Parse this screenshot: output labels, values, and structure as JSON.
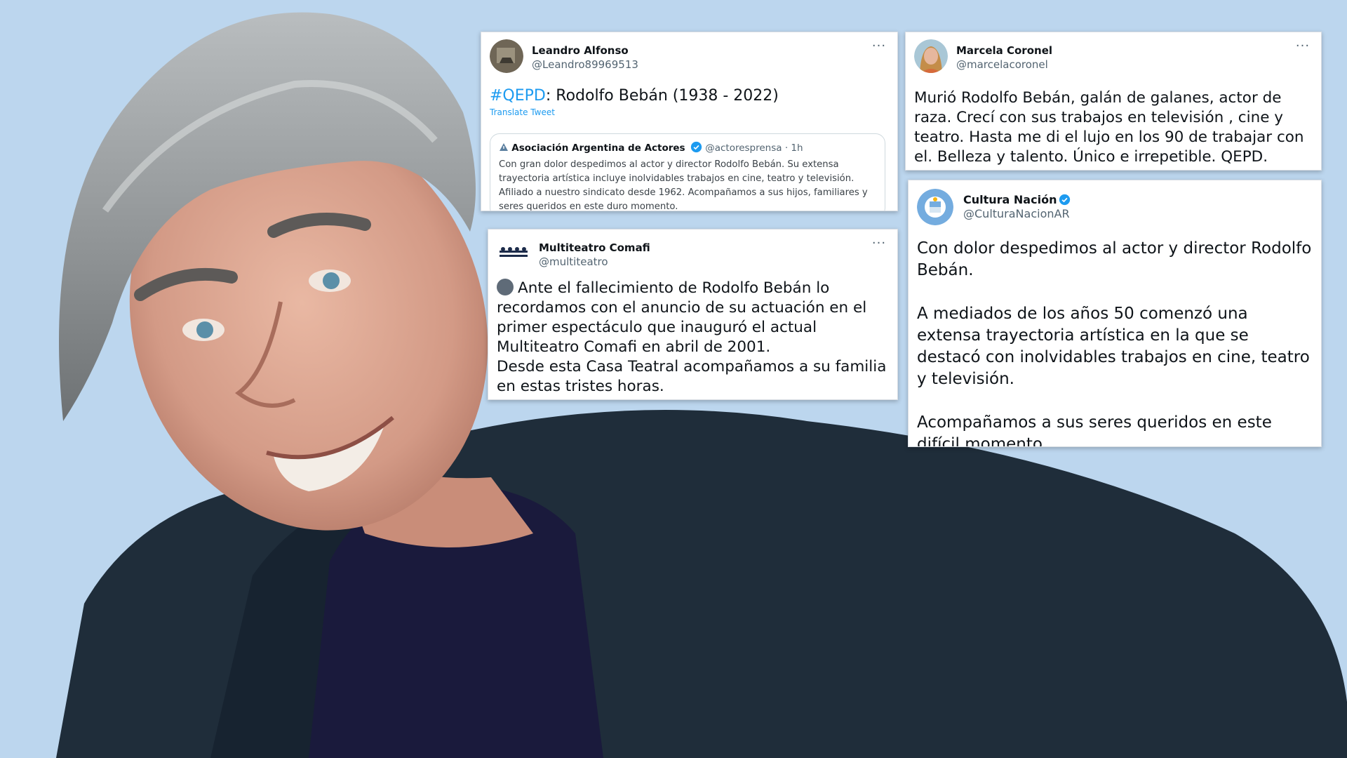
{
  "tweets": {
    "leandro": {
      "name": "Leandro Alfonso",
      "handle": "@Leandro89969513",
      "more": "···",
      "hashtag": "#QEPD",
      "text": ": Rodolfo Bebán (1938 - 2022)",
      "translate": "Translate Tweet",
      "quote": {
        "name": "Asociación Argentina de Actores",
        "handle": "@actoresprensa",
        "sep": " · ",
        "time": "1h",
        "text": "Con gran dolor despedimos al actor y director Rodolfo Bebán. Su extensa trayectoria artística incluye inolvidables trabajos en cine, teatro y televisión. Afiliado a nuestro sindicato desde 1962. Acompañamos a sus hijos, familiares y seres queridos en este duro momento."
      }
    },
    "multiteatro": {
      "name": "Multiteatro Comafi",
      "handle": "@multiteatro",
      "more": "···",
      "line1": "Ante el fallecimiento de Rodolfo Bebán lo recordamos con el anuncio de su actuación en el primer espectáculo que inauguró el actual Multiteatro Comafi en abril de 2001.",
      "line2": "Desde esta Casa Teatral acompañamos a su familia en estas tristes horas."
    },
    "marcela": {
      "name": "Marcela Coronel",
      "handle": "@marcelacoronel",
      "more": "···",
      "text": "Murió Rodolfo Bebán, galán de galanes, actor de raza. Crecí con sus trabajos en televisión , cine y teatro. Hasta me di el lujo en los 90 de trabajar con el. Belleza y talento. Único e irrepetible. QEPD."
    },
    "cultura": {
      "name": "Cultura Nación",
      "handle": "@CulturaNacionAR",
      "p1": "Con dolor despedimos al actor y director Rodolfo Bebán.",
      "p2": "A mediados de los años 50 comenzó una extensa trayectoria artística en la que se destacó con inolvidables trabajos en cine, teatro y televisión.",
      "p3": "Acompañamos a sus seres queridos en este difícil momento."
    }
  },
  "icons": {
    "verified": "verified-badge-icon",
    "more": "more-options-icon"
  },
  "colors": {
    "background": "#bcd6ee",
    "link": "#1d9bf0",
    "text": "#0f1419",
    "muted": "#536471"
  }
}
